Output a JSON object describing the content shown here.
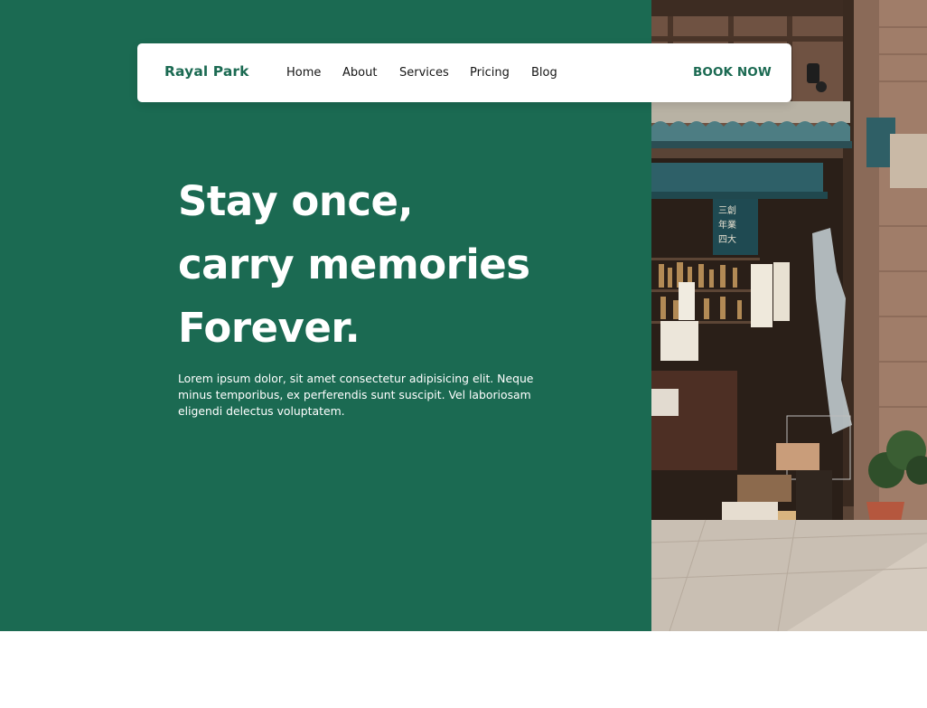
{
  "nav": {
    "brand": "Rayal Park",
    "links": [
      "Home",
      "About",
      "Services",
      "Pricing",
      "Blog"
    ],
    "cta": "BOOK NOW"
  },
  "hero": {
    "headline": [
      "Stay once,",
      "carry memories",
      "Forever."
    ],
    "body": "Lorem ipsum dolor, sit amet consectetur adipisicing elit. Neque minus temporibus, ex perferendis sunt suscipit. Vel laboriosam eligendi delectus voluptatem."
  },
  "colors": {
    "brand_green": "#1b6a52",
    "nav_background": "#ffffff",
    "text_dark": "#151515",
    "text_light": "#ffffff",
    "page_background": "#ffffff"
  }
}
